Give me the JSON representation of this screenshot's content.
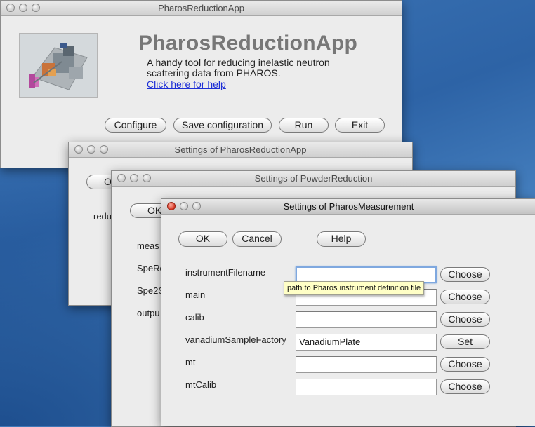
{
  "main_window": {
    "title": "PharosReductionApp",
    "app_name": "PharosReductionApp",
    "description_line1": "A handy tool for reducing inelastic neutron",
    "description_line2": "scattering data from PHAROS.",
    "help_link": "Click here for help",
    "buttons": {
      "configure": "Configure",
      "save_configuration": "Save configuration",
      "run": "Run",
      "exit": "Exit"
    }
  },
  "settings_app_window": {
    "title": "Settings of PharosReductionApp",
    "ok_partial": "O",
    "label_partial": "redu"
  },
  "settings_powder_window": {
    "title": "Settings of PowderReduction",
    "ok_partial": "OK",
    "labels_partial": [
      "meas",
      "SpeRe",
      "Spe2S",
      "outpu"
    ]
  },
  "settings_measurement_window": {
    "title": "Settings of PharosMeasurement",
    "buttons": {
      "ok": "OK",
      "cancel": "Cancel",
      "help": "Help"
    },
    "fields": [
      {
        "label": "instrumentFilename",
        "value": "",
        "action": "Choose"
      },
      {
        "label": "main",
        "value": "",
        "action": "Choose"
      },
      {
        "label": "calib",
        "value": "",
        "action": "Choose"
      },
      {
        "label": "vanadiumSampleFactory",
        "value": "VanadiumPlate",
        "action": "Set"
      },
      {
        "label": "mt",
        "value": "",
        "action": "Choose"
      },
      {
        "label": "mtCalib",
        "value": "",
        "action": "Choose"
      }
    ],
    "tooltip": "path to Pharos instrument definition file"
  }
}
